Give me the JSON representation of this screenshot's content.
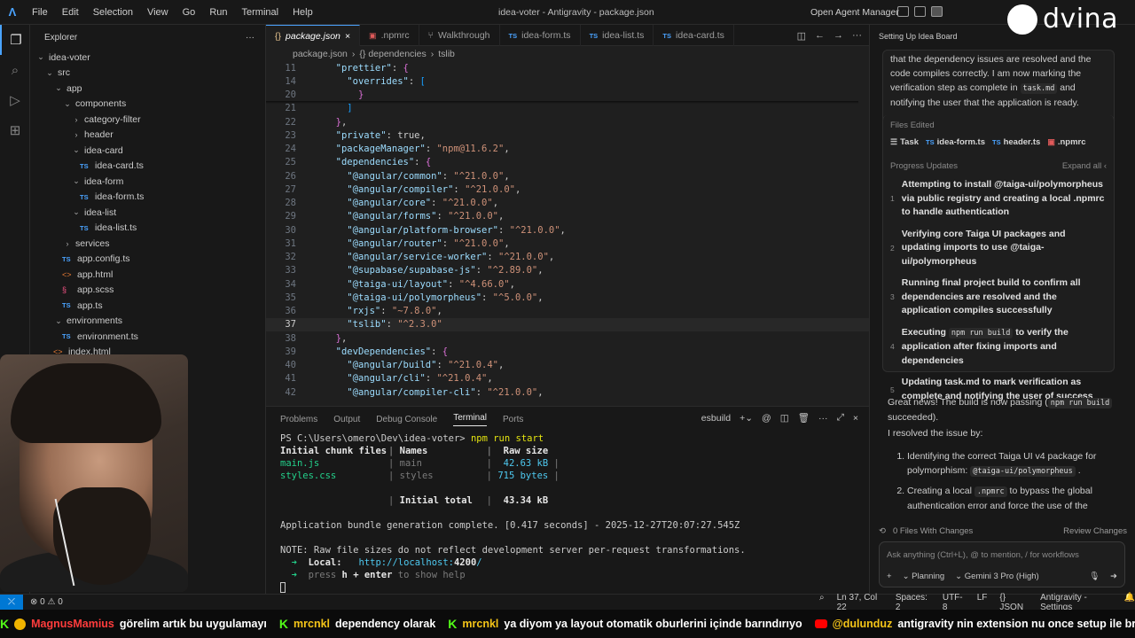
{
  "app": {
    "window_title": "idea-voter - Antigravity - package.json",
    "menu": [
      "File",
      "Edit",
      "Selection",
      "View",
      "Go",
      "Run",
      "Terminal",
      "Help"
    ],
    "open_agent_manager": "Open Agent Manager"
  },
  "watermark": "dvina",
  "explorer": {
    "title": "Explorer",
    "more": "···",
    "tree": [
      {
        "label": "idea-voter",
        "depth": 0,
        "kind": "folder-open"
      },
      {
        "label": "src",
        "depth": 1,
        "kind": "folder-open"
      },
      {
        "label": "app",
        "depth": 2,
        "kind": "folder-open"
      },
      {
        "label": "components",
        "depth": 3,
        "kind": "folder-open"
      },
      {
        "label": "category-filter",
        "depth": 4,
        "kind": "folder"
      },
      {
        "label": "header",
        "depth": 4,
        "kind": "folder"
      },
      {
        "label": "idea-card",
        "depth": 4,
        "kind": "folder-open"
      },
      {
        "label": "idea-card.ts",
        "depth": 5,
        "kind": "ts"
      },
      {
        "label": "idea-form",
        "depth": 4,
        "kind": "folder-open"
      },
      {
        "label": "idea-form.ts",
        "depth": 5,
        "kind": "ts"
      },
      {
        "label": "idea-list",
        "depth": 4,
        "kind": "folder-open"
      },
      {
        "label": "idea-list.ts",
        "depth": 5,
        "kind": "ts"
      },
      {
        "label": "services",
        "depth": 3,
        "kind": "folder"
      },
      {
        "label": "app.config.ts",
        "depth": 3,
        "kind": "ts"
      },
      {
        "label": "app.html",
        "depth": 3,
        "kind": "html"
      },
      {
        "label": "app.scss",
        "depth": 3,
        "kind": "scss"
      },
      {
        "label": "app.ts",
        "depth": 3,
        "kind": "ts"
      },
      {
        "label": "environments",
        "depth": 2,
        "kind": "folder-open"
      },
      {
        "label": "environment.ts",
        "depth": 3,
        "kind": "ts"
      },
      {
        "label": "index.html",
        "depth": 2,
        "kind": "html"
      }
    ]
  },
  "tabs": [
    {
      "label": "package.json",
      "icon": "{}",
      "active": true,
      "close": "×"
    },
    {
      "label": ".npmrc",
      "icon": "npm",
      "active": false
    },
    {
      "label": "Walkthrough",
      "icon": "walk",
      "active": false
    },
    {
      "label": "idea-form.ts",
      "icon": "TS",
      "active": false
    },
    {
      "label": "idea-list.ts",
      "icon": "TS",
      "active": false
    },
    {
      "label": "idea-card.ts",
      "icon": "TS",
      "active": false
    }
  ],
  "breadcrumb": [
    "package.json",
    "{} dependencies",
    "tslib"
  ],
  "code": [
    {
      "ln": "11",
      "text": "  \"prettier\": {"
    },
    {
      "ln": "14",
      "text": "    \"overrides\": ["
    },
    {
      "ln": "20",
      "text": "      }"
    },
    {
      "ln": "21",
      "text": "    ]"
    },
    {
      "ln": "22",
      "text": "  },"
    },
    {
      "ln": "23",
      "text": "  \"private\": true,"
    },
    {
      "ln": "24",
      "text": "  \"packageManager\": \"npm@11.6.2\","
    },
    {
      "ln": "25",
      "text": "  \"dependencies\": {"
    },
    {
      "ln": "26",
      "text": "    \"@angular/common\": \"^21.0.0\","
    },
    {
      "ln": "27",
      "text": "    \"@angular/compiler\": \"^21.0.0\","
    },
    {
      "ln": "28",
      "text": "    \"@angular/core\": \"^21.0.0\","
    },
    {
      "ln": "29",
      "text": "    \"@angular/forms\": \"^21.0.0\","
    },
    {
      "ln": "30",
      "text": "    \"@angular/platform-browser\": \"^21.0.0\","
    },
    {
      "ln": "31",
      "text": "    \"@angular/router\": \"^21.0.0\","
    },
    {
      "ln": "32",
      "text": "    \"@angular/service-worker\": \"^21.0.0\","
    },
    {
      "ln": "33",
      "text": "    \"@supabase/supabase-js\": \"^2.89.0\","
    },
    {
      "ln": "34",
      "text": "    \"@taiga-ui/layout\": \"^4.66.0\","
    },
    {
      "ln": "35",
      "text": "    \"@taiga-ui/polymorpheus\": \"^5.0.0\","
    },
    {
      "ln": "36",
      "text": "    \"rxjs\": \"~7.8.0\","
    },
    {
      "ln": "37",
      "text": "    \"tslib\": \"^2.3.0\"",
      "current": true
    },
    {
      "ln": "38",
      "text": "  },"
    },
    {
      "ln": "39",
      "text": "  \"devDependencies\": {"
    },
    {
      "ln": "40",
      "text": "    \"@angular/build\": \"^21.0.4\","
    },
    {
      "ln": "41",
      "text": "    \"@angular/cli\": \"^21.0.4\","
    },
    {
      "ln": "42",
      "text": "    \"@angular/compiler-cli\": \"^21.0.0\","
    }
  ],
  "panel": {
    "tabs": [
      "Problems",
      "Output",
      "Debug Console",
      "Terminal",
      "Ports"
    ],
    "active_tab": "Terminal",
    "shell": "esbuild",
    "prompt": "PS C:\\Users\\omero\\Dev\\idea-voter>",
    "command": "npm run start",
    "table_header": [
      "Initial chunk files",
      "Names",
      "Raw size"
    ],
    "rows": [
      [
        "main.js",
        "main",
        "42.63 kB"
      ],
      [
        "styles.css",
        "styles",
        "715 bytes"
      ]
    ],
    "total_label": "Initial total",
    "total_value": "43.34 kB",
    "bundle_msg": "Application bundle generation complete. [0.417 seconds] - 2025-12-27T20:07:27.545Z",
    "note": "NOTE: Raw file sizes do not reflect development server per-request transformations.",
    "local_label": "Local:",
    "local_url_prefix": "http://localhost:",
    "local_url_port": "4200",
    "local_url_suffix": "/",
    "press_help": [
      "press",
      "h + enter",
      "to show help"
    ]
  },
  "agent": {
    "title": "Setting Up Idea Board",
    "intro_a": "that the dependency issues are resolved and the code compiles correctly. I am now marking the verification step as complete in",
    "intro_file": "task.md",
    "intro_b": "and notifying the user that the application is ready.",
    "files_edited_label": "Files Edited",
    "files_edited": [
      {
        "icon": "task",
        "label": "Task"
      },
      {
        "icon": "TS",
        "label": "idea-form.ts"
      },
      {
        "icon": "TS",
        "label": "header.ts"
      },
      {
        "icon": "npm",
        "label": ".npmrc"
      }
    ],
    "progress_label": "Progress Updates",
    "expand_all": "Expand all",
    "progress": [
      {
        "n": "1",
        "text": "Attempting to install @taiga-ui/polymorpheus via public registry and creating a local .npmrc to handle authentication"
      },
      {
        "n": "2",
        "text": "Verifying core Taiga UI packages and updating imports to use @taiga-ui/polymorpheus"
      },
      {
        "n": "3",
        "text": "Running final project build to confirm all dependencies are resolved and the application compiles successfully"
      },
      {
        "n": "4",
        "text_a": "Executing",
        "code": "npm run build",
        "text_b": "to verify the application after fixing imports and dependencies"
      },
      {
        "n": "5",
        "text": "Updating task.md to mark verification as complete and notifying the user of success"
      }
    ],
    "msg_a": "Great news! The build is now passing (",
    "msg_code": "npm run build",
    "msg_b": " succeeded).",
    "resolved": "I resolved the issue by:",
    "list": [
      {
        "a": "Identifying the correct Taiga UI v4 package for polymorphism:",
        "code": "@taiga-ui/polymorpheus",
        "b": "."
      },
      {
        "a": "Creating a local",
        "code": ".npmrc",
        "b": "to bypass the global authentication error and force the use of the"
      }
    ],
    "files_changes": "0 Files With Changes",
    "review_changes": "Review Changes",
    "input_placeholder": "Ask anything (Ctrl+L), @ to mention, / for workflows",
    "mode": "Planning",
    "model": "Gemini 3 Pro (High)"
  },
  "statusbar": {
    "errors": "0",
    "warnings": "0",
    "position": "Ln 37, Col 22",
    "spaces": "Spaces: 2",
    "encoding": "UTF-8",
    "eol": "LF",
    "language": "JSON",
    "settings": "Antigravity - Settings"
  },
  "ticker": [
    {
      "platform": "kick",
      "user": "MagnusMamius",
      "text": "görelim artık bu uygulamayı",
      "color": "#ff3c3c"
    },
    {
      "platform": "kick",
      "user": "mrcnkl",
      "text": "dependency olarak",
      "color": "#f5c518"
    },
    {
      "platform": "kick",
      "user": "mrcnkl",
      "text": "ya diyom ya layout otomatik oburlerini içinde barındırıyo",
      "color": "#f5c518"
    },
    {
      "platform": "youtube",
      "user": "@dulunduz",
      "text": "antigravity nin extension nu once setup ile browser k",
      "color": "#f5c518"
    }
  ]
}
